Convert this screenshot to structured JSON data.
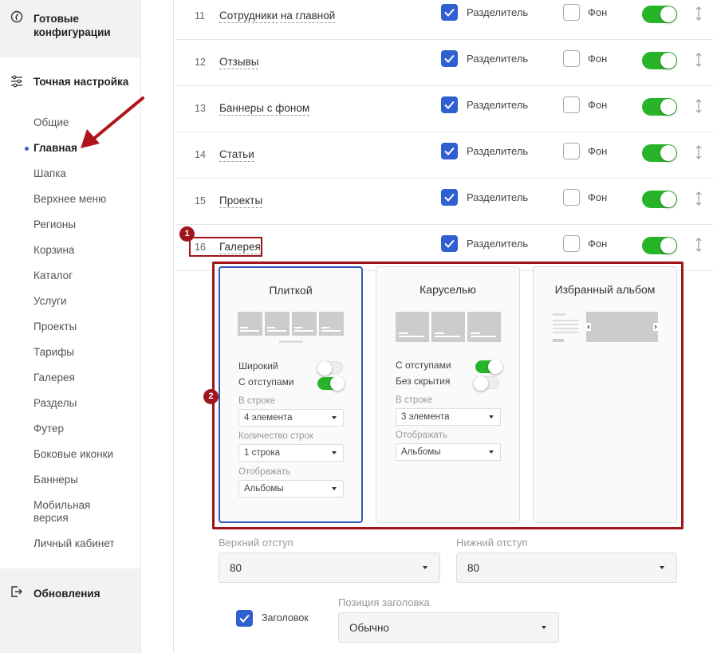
{
  "sidebar": {
    "ready_configs": "Готовые конфигурации",
    "fine_tuning": "Точная настройка",
    "items": [
      "Общие",
      "Главная",
      "Шапка",
      "Верхнее меню",
      "Регионы",
      "Корзина",
      "Каталог",
      "Услуги",
      "Проекты",
      "Тарифы",
      "Галерея",
      "Разделы",
      "Футер",
      "Боковые иконки",
      "Баннеры",
      "Мобильная версия",
      "Личный кабинет"
    ],
    "active_item": "Главная",
    "updates": "Обновления"
  },
  "rows": [
    {
      "num": "11",
      "name": "Сотрудники на главной",
      "divider_label": "Разделитель",
      "divider": true,
      "bg_label": "Фон",
      "bg": false,
      "enabled": true
    },
    {
      "num": "12",
      "name": "Отзывы",
      "divider_label": "Разделитель",
      "divider": true,
      "bg_label": "Фон",
      "bg": false,
      "enabled": true
    },
    {
      "num": "13",
      "name": "Баннеры с фоном",
      "divider_label": "Разделитель",
      "divider": true,
      "bg_label": "Фон",
      "bg": false,
      "enabled": true
    },
    {
      "num": "14",
      "name": "Статьи",
      "divider_label": "Разделитель",
      "divider": true,
      "bg_label": "Фон",
      "bg": false,
      "enabled": true
    },
    {
      "num": "15",
      "name": "Проекты",
      "divider_label": "Разделитель",
      "divider": true,
      "bg_label": "Фон",
      "bg": false,
      "enabled": true
    },
    {
      "num": "16",
      "name": "Галерея",
      "divider_label": "Разделитель",
      "divider": true,
      "bg_label": "Фон",
      "bg": false,
      "enabled": true
    }
  ],
  "gallery": {
    "tile": {
      "title": "Плиткой",
      "wide_label": "Широкий",
      "wide": false,
      "padding_label": "С отступами",
      "padding": true,
      "per_row_label": "В строке",
      "per_row": "4 элемента",
      "rows_count_label": "Количество строк",
      "rows_count": "1 строка",
      "display_label": "Отображать",
      "display": "Альбомы"
    },
    "carousel": {
      "title": "Каруселью",
      "padding_label": "С отступами",
      "padding": true,
      "no_hide_label": "Без скрытия",
      "no_hide": false,
      "per_row_label": "В строке",
      "per_row": "3 элемента",
      "display_label": "Отображать",
      "display": "Альбомы"
    },
    "album": {
      "title": "Избранный альбом"
    }
  },
  "spacing": {
    "top_label": "Верхний отступ",
    "top": "80",
    "bottom_label": "Нижний отступ",
    "bottom": "80"
  },
  "heading": {
    "checkbox_label": "Заголовок",
    "checked": true,
    "position_label": "Позиция заголовка",
    "position": "Обычно"
  },
  "markers": [
    "1",
    "2"
  ],
  "colors": {
    "accent": "#2f5fd0",
    "toggle_on": "#28b428",
    "highlight": "#a0141b"
  }
}
